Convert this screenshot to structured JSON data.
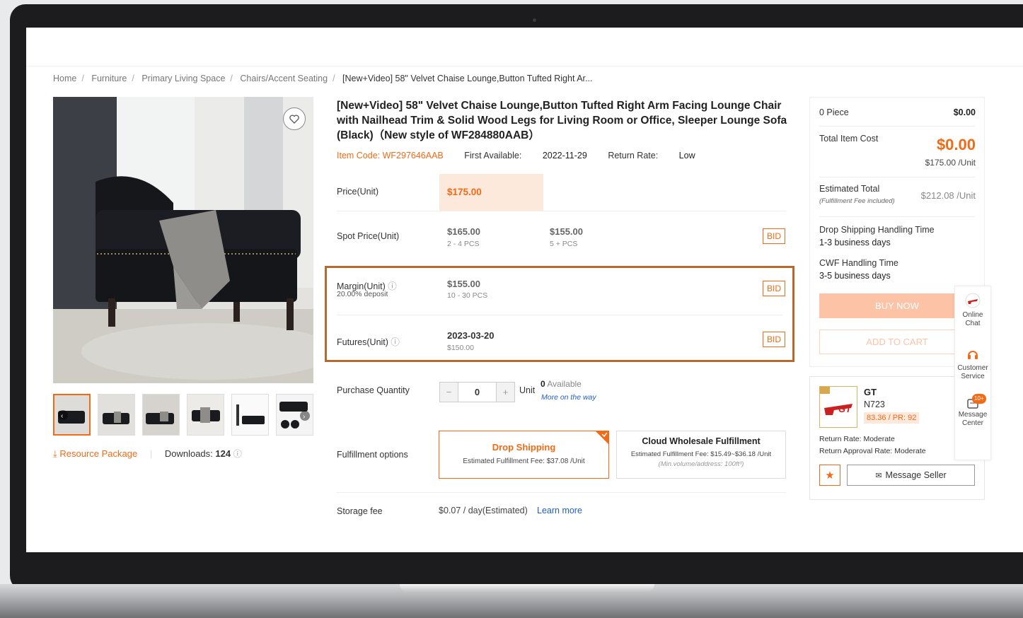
{
  "breadcrumb": {
    "items": [
      "Home",
      "Furniture",
      "Primary Living Space",
      "Chairs/Accent Seating"
    ],
    "current": "[New+Video] 58\" Velvet Chaise Lounge,Button Tufted Right Ar..."
  },
  "product": {
    "title": "[New+Video] 58\" Velvet Chaise Lounge,Button Tufted Right Arm Facing Lounge Chair with Nailhead Trim & Solid Wood Legs for Living Room or Office, Sleeper Lounge Sofa (Black)（New style of WF284880AAB）",
    "item_code": "Item Code: WF297646AAB",
    "first_available_label": "First Available:",
    "first_available": "2022-11-29",
    "return_rate_label": "Return Rate:",
    "return_rate": "Low"
  },
  "pricing": {
    "price_label": "Price(Unit)",
    "price": "$175.00",
    "spot_label": "Spot Price(Unit)",
    "spot": [
      {
        "price": "$165.00",
        "qty": "2 - 4 PCS"
      },
      {
        "price": "$155.00",
        "qty": "5 + PCS"
      }
    ],
    "margin_label": "Margin(Unit)",
    "margin_deposit": "20.00% deposit",
    "margin_price": "$155.00",
    "margin_qty": "10 - 30 PCS",
    "futures_label": "Futures(Unit)",
    "futures_date": "2023-03-20",
    "futures_price": "$150.00",
    "bid_label": "BID"
  },
  "purchase": {
    "label": "Purchase Quantity",
    "minus": "−",
    "quantity": "0",
    "plus": "+",
    "unit": "Unit",
    "available_count": "0",
    "available_label": "Available",
    "more_on_way": "More on the way"
  },
  "fulfillment": {
    "label": "Fulfillment options",
    "drop_title": "Drop Shipping",
    "drop_fee": "Estimated Fulfillment Fee: $37.08 /Unit",
    "cwf_title": "Cloud Wholesale Fulfillment",
    "cwf_fee": "Estimated Fulfillment Fee: $15.49~$36.18 /Unit",
    "cwf_note": "(Min.volume/address: 100ft³)"
  },
  "storage": {
    "label": "Storage fee",
    "value": "$0.07 / day(Estimated)",
    "learn_more": "Learn more"
  },
  "resources": {
    "package": "Resource Package",
    "downloads_label": "Downloads:",
    "downloads": "124"
  },
  "summary": {
    "pieces": "0 Piece",
    "pieces_cost": "$0.00",
    "total_label": "Total Item Cost",
    "total": "$0.00",
    "unit_price": "$175.00 /Unit",
    "est_label": "Estimated Total",
    "est_note": "(Fulfillment Fee included)",
    "est_value": "$212.08 /Unit",
    "ds_handling_label": "Drop Shipping Handling Time",
    "ds_handling": "1-3 business days",
    "cwf_handling_label": "CWF Handling Time",
    "cwf_handling": "3-5 business days",
    "buy_now": "BUY NOW",
    "add_to_cart": "ADD TO CART"
  },
  "seller": {
    "logo_text": "GT",
    "name": "GT",
    "code": "N723",
    "rating": "83.36 / PR: 92",
    "return_rate_label": "Return Rate:",
    "return_rate": "Moderate",
    "approval_label": "Return Approval Rate:",
    "approval": "Moderate",
    "message": "Message Seller"
  },
  "sidebar": {
    "chat_line1": "Online",
    "chat_line2": "Chat",
    "service_line1": "Customer",
    "service_line2": "Service",
    "msg_badge": "10+",
    "msg_line1": "Message",
    "msg_line2": "Center"
  },
  "colors": {
    "accent": "#f36a16",
    "highlight_border": "#b8692e",
    "link": "#1f5ec2"
  }
}
